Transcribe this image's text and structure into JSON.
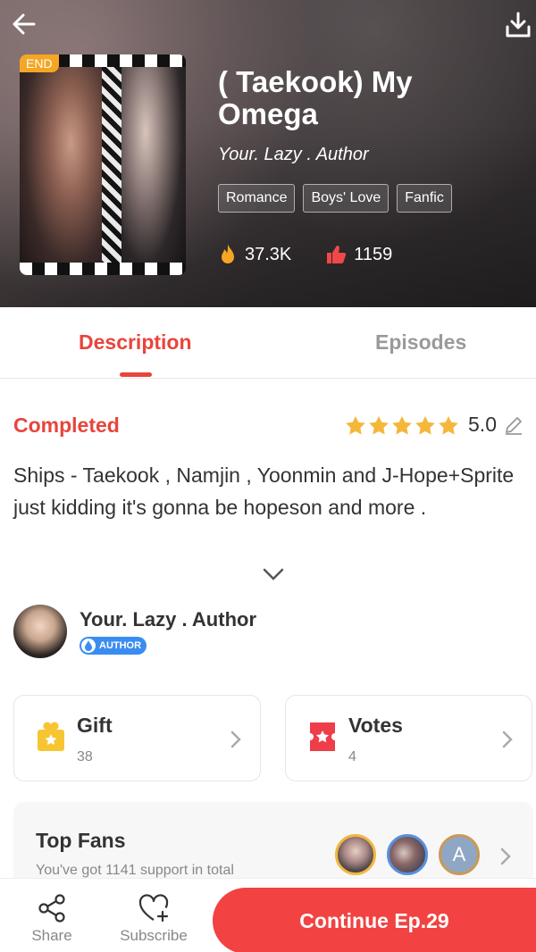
{
  "book": {
    "status_badge": "END",
    "title": "( Taekook) My Omega",
    "author": "Your. Lazy . Author",
    "tags": [
      "Romance",
      "Boys' Love",
      "Fanfic"
    ],
    "views": "37.3K",
    "likes": "1159"
  },
  "tabs": {
    "description": "Description",
    "episodes": "Episodes"
  },
  "summary": {
    "status": "Completed",
    "rating": "5.0",
    "text": "Ships - Taekook , Namjin , Yoonmin and J-Hope+Sprite just kidding it's gonna be hopeson and more ."
  },
  "author_section": {
    "name": "Your. Lazy . Author",
    "badge": "AUTHOR"
  },
  "gift": {
    "title": "Gift",
    "count": "38"
  },
  "votes": {
    "title": "Votes",
    "count": "4"
  },
  "fans": {
    "title": "Top Fans",
    "subtitle": "You've got 1141 support in total",
    "third_initial": "A"
  },
  "bottom_bar": {
    "share": "Share",
    "subscribe": "Subscribe",
    "continue": "Continue Ep.29"
  },
  "colors": {
    "accent": "#e8453c",
    "continue_bg": "#f24242",
    "star": "#f5b73b"
  }
}
